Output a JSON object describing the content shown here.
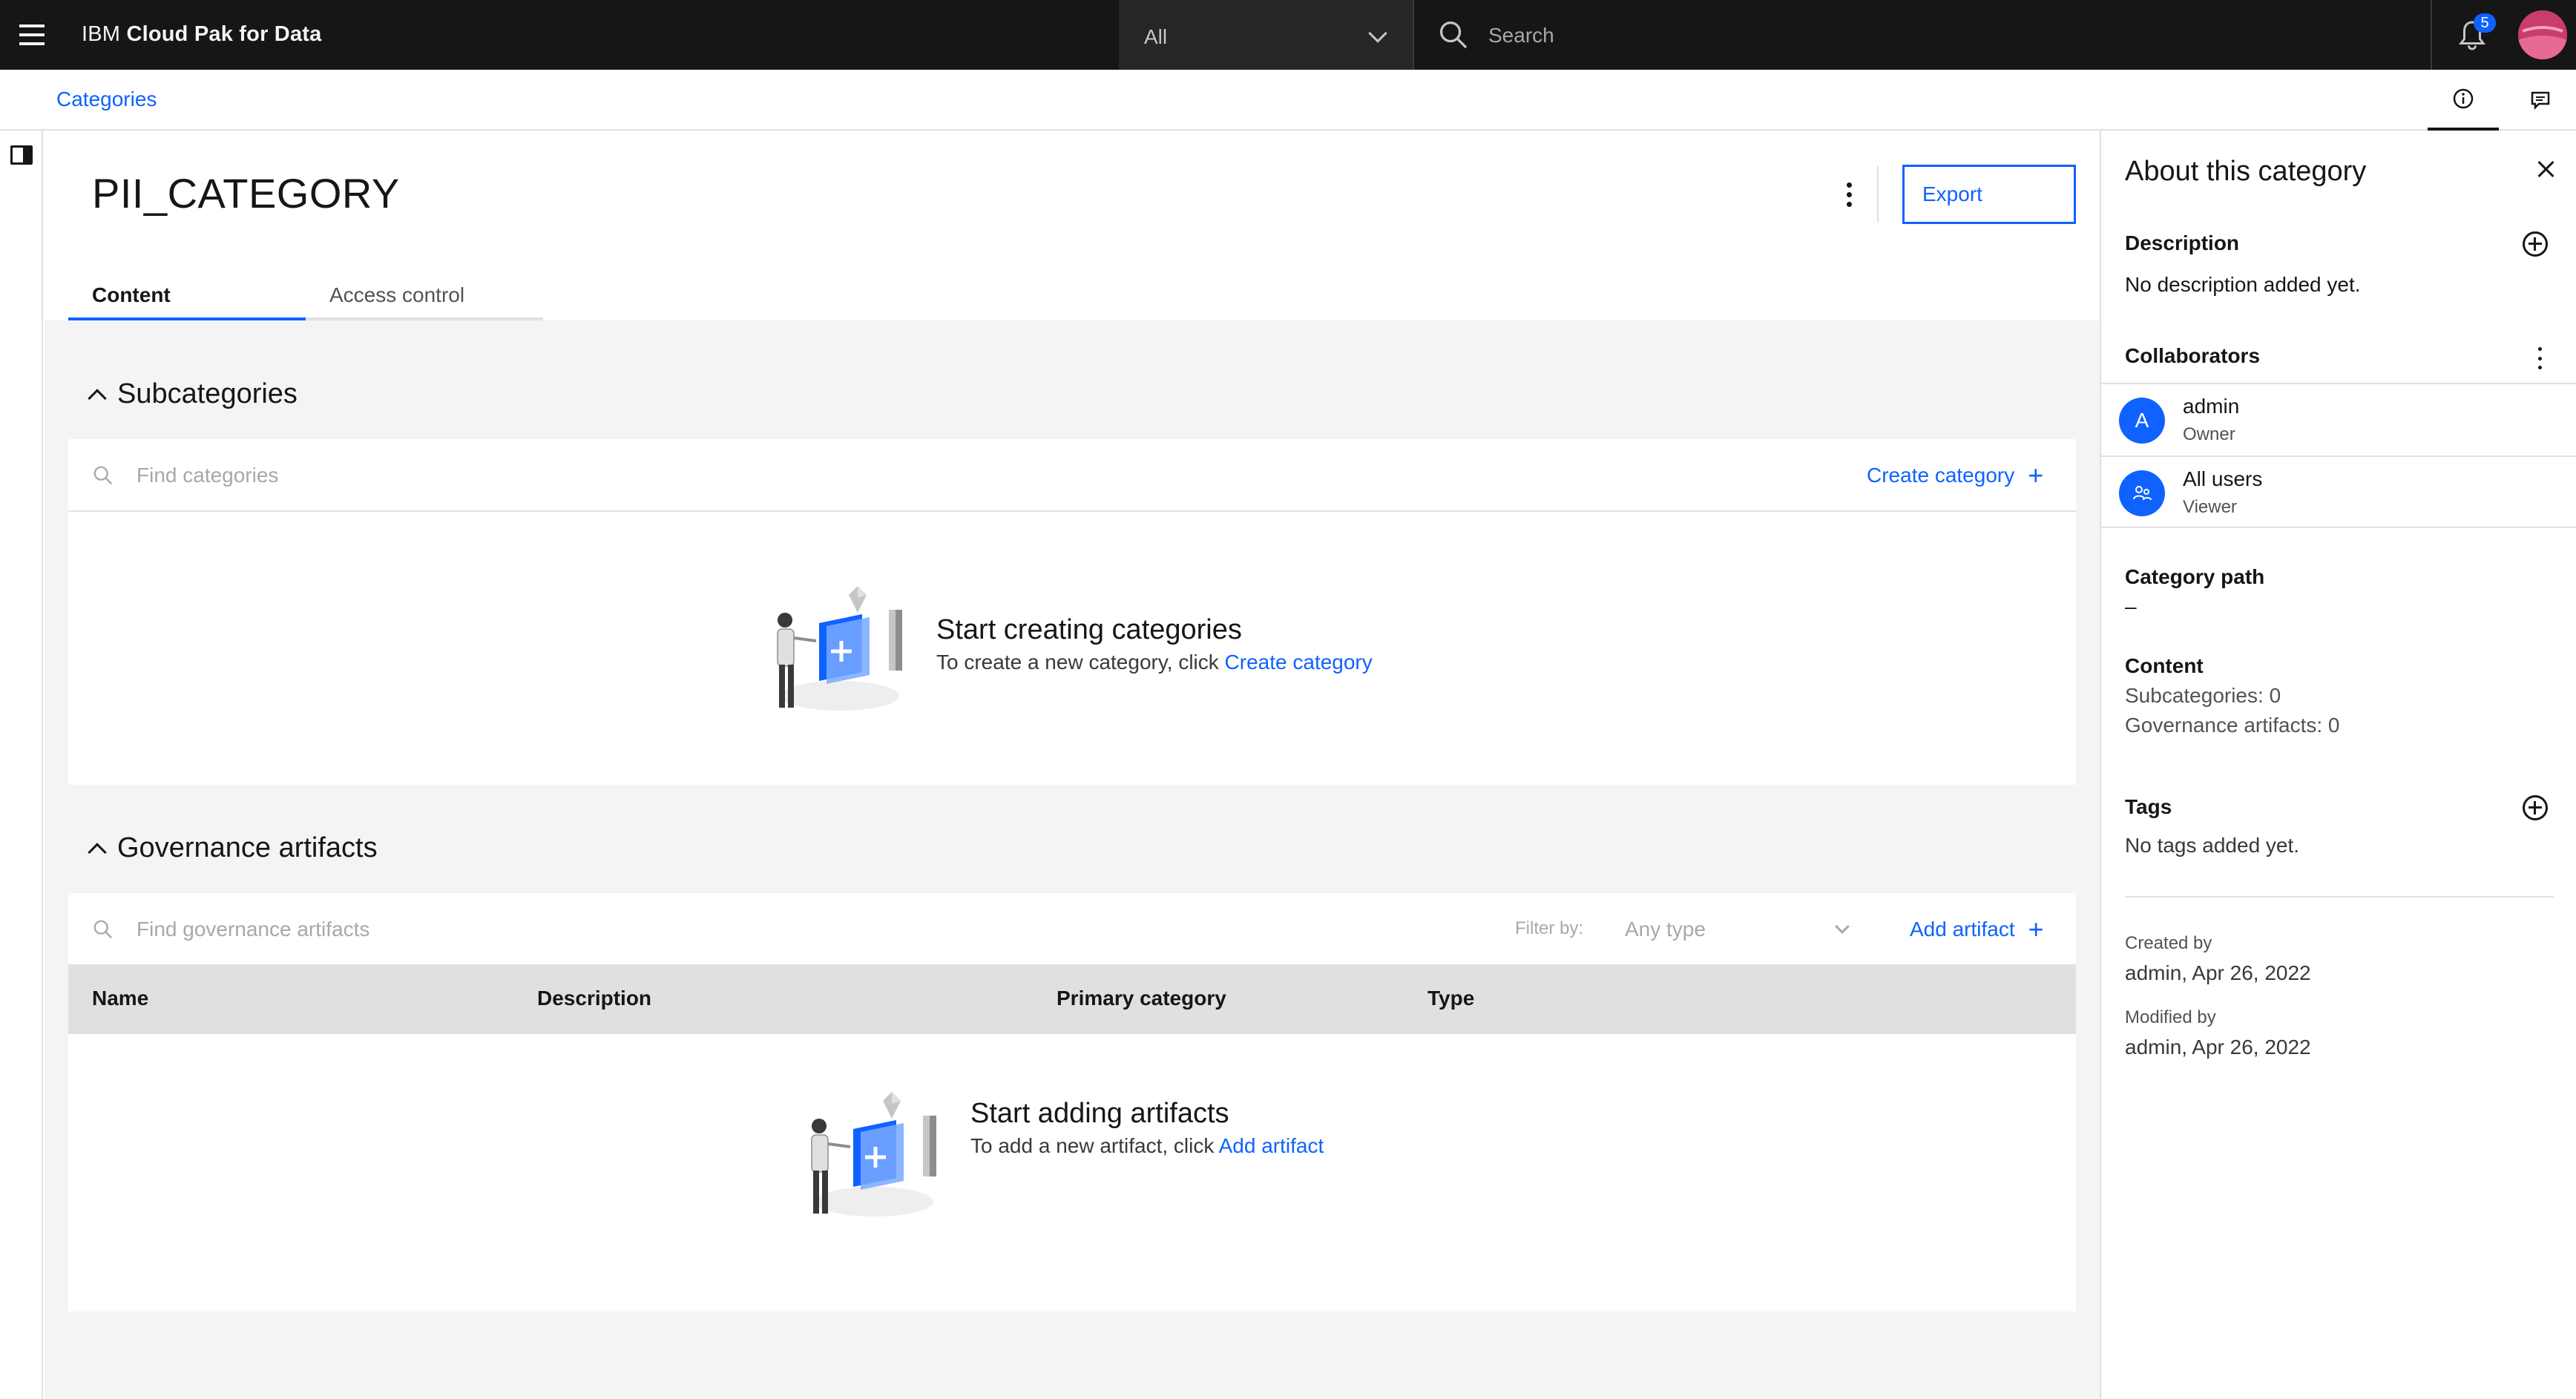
{
  "header": {
    "brand_prefix": "IBM",
    "brand_name": "Cloud Pak for Data",
    "scope_value": "All",
    "search_placeholder": "Search",
    "notification_count": "5"
  },
  "breadcrumb": {
    "item": "Categories"
  },
  "page": {
    "title": "PII_CATEGORY",
    "export_label": "Export",
    "tabs": [
      {
        "label": "Content",
        "active": true
      },
      {
        "label": "Access control",
        "active": false
      }
    ]
  },
  "subcategories": {
    "heading": "Subcategories",
    "search_placeholder": "Find categories",
    "create_label": "Create category",
    "empty_title": "Start creating categories",
    "empty_text": "To create a new category, click",
    "empty_link": "Create category"
  },
  "artifacts": {
    "heading": "Governance artifacts",
    "search_placeholder": "Find governance artifacts",
    "filter_label": "Filter by:",
    "type_placeholder": "Any type",
    "add_label": "Add artifact",
    "columns": [
      "Name",
      "Description",
      "Primary category",
      "Type"
    ],
    "empty_title": "Start adding artifacts",
    "empty_text": "To add a new artifact, click",
    "empty_link": "Add artifact"
  },
  "sidepanel": {
    "title": "About this category",
    "description_label": "Description",
    "description_value": "No description added yet.",
    "collaborators_label": "Collaborators",
    "collaborators": [
      {
        "initial": "A",
        "name": "admin",
        "role": "Owner"
      },
      {
        "initial": "",
        "name": "All users",
        "role": "Viewer"
      }
    ],
    "path_label": "Category path",
    "path_value": "–",
    "content_label": "Content",
    "subcategories_count": "Subcategories:  0",
    "artifacts_count": "Governance artifacts:  0",
    "tags_label": "Tags",
    "tags_value": "No tags added yet.",
    "created_label": "Created by",
    "created_value": "admin,  Apr 26, 2022",
    "modified_label": "Modified by",
    "modified_value": "admin,  Apr 26, 2022"
  },
  "colors": {
    "primary": "#0f62fe",
    "header_bg": "#161616",
    "content_bg": "#f4f4f4"
  }
}
